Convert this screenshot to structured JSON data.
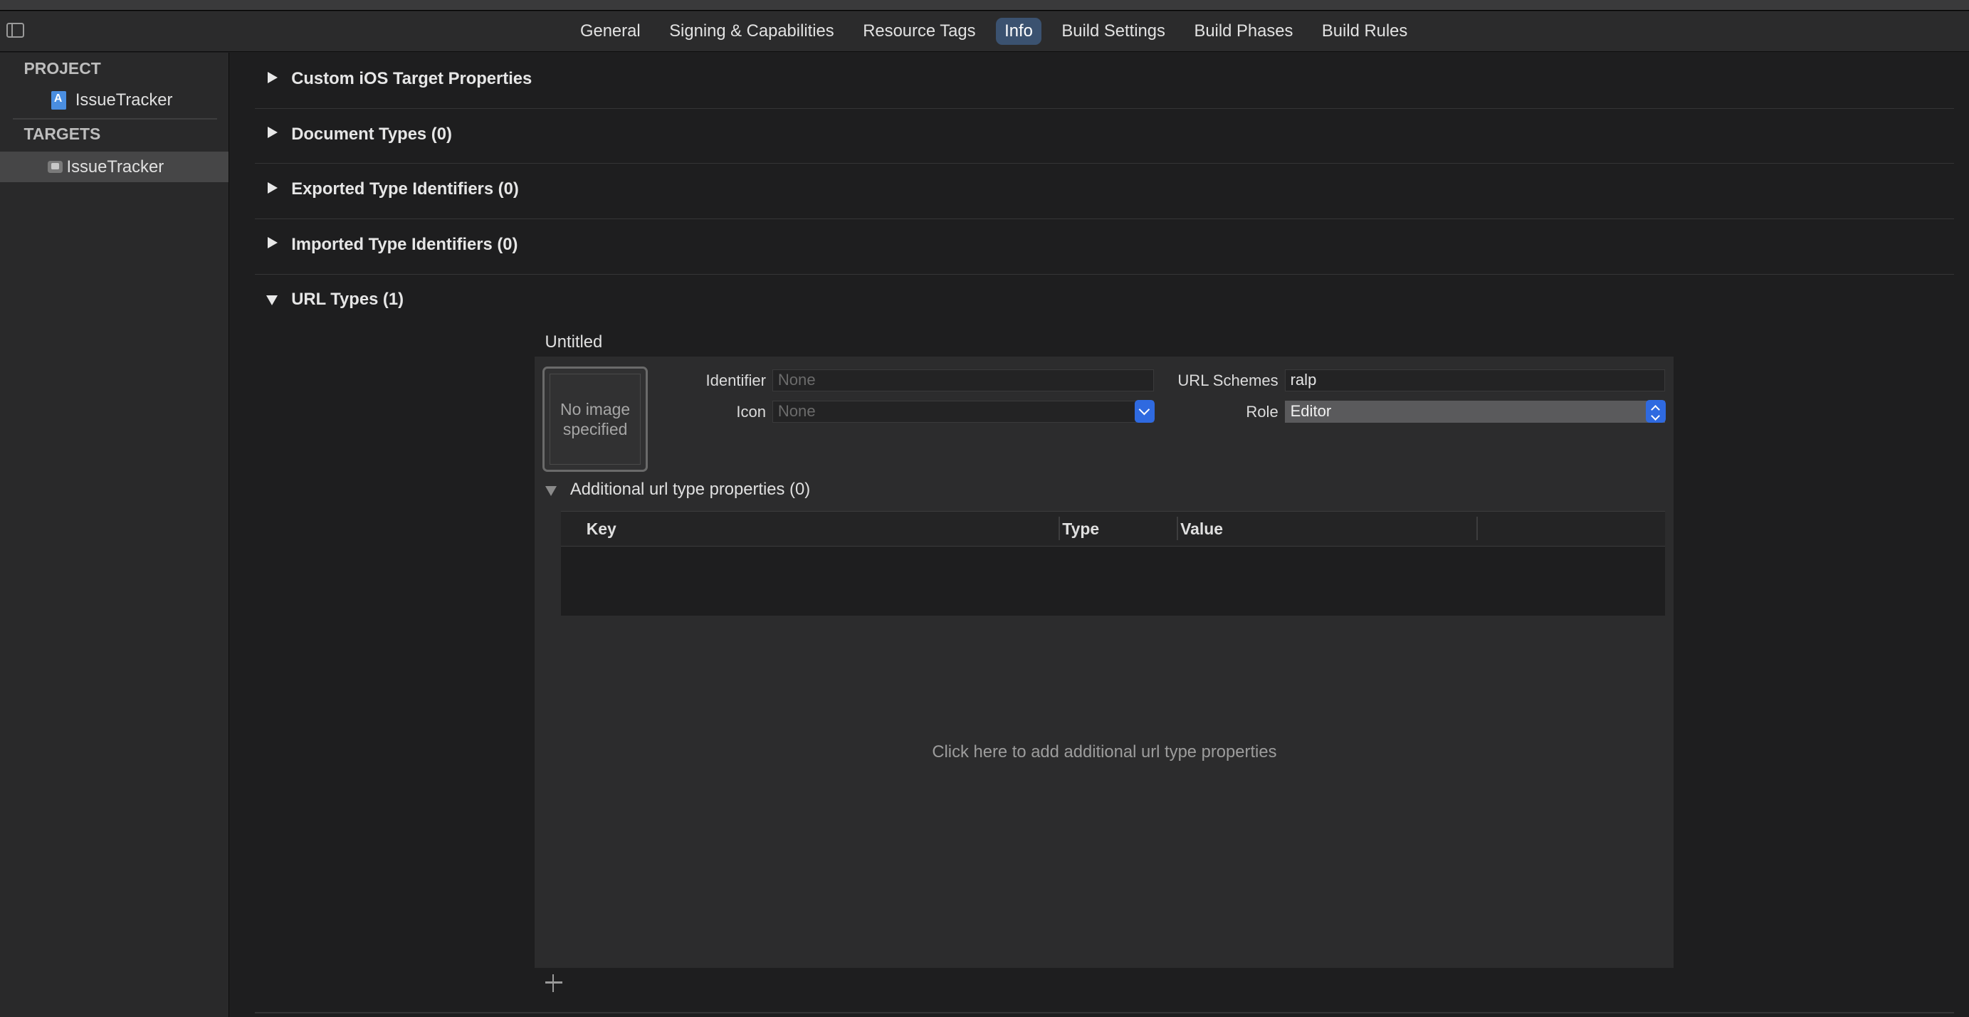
{
  "tabbar": {
    "tabs": [
      {
        "label": "General",
        "active": false
      },
      {
        "label": "Signing & Capabilities",
        "active": false
      },
      {
        "label": "Resource Tags",
        "active": false
      },
      {
        "label": "Info",
        "active": true
      },
      {
        "label": "Build Settings",
        "active": false
      },
      {
        "label": "Build Phases",
        "active": false
      },
      {
        "label": "Build Rules",
        "active": false
      }
    ]
  },
  "sidebar": {
    "project_heading": "PROJECT",
    "project_item": "IssueTracker",
    "targets_heading": "TARGETS",
    "target_item": "IssueTracker"
  },
  "sections": [
    {
      "title": "Custom iOS Target Properties",
      "expanded": false
    },
    {
      "title": "Document Types (0)",
      "expanded": false
    },
    {
      "title": "Exported Type Identifiers (0)",
      "expanded": false
    },
    {
      "title": "Imported Type Identifiers (0)",
      "expanded": false
    },
    {
      "title": "URL Types (1)",
      "expanded": true
    }
  ],
  "url_type": {
    "name": "Untitled",
    "image_placeholder": "No image specified",
    "identifier_label": "Identifier",
    "identifier_placeholder": "None",
    "icon_label": "Icon",
    "icon_placeholder": "None",
    "url_schemes_label": "URL Schemes",
    "url_schemes_value": "ralp",
    "role_label": "Role",
    "role_value": "Editor",
    "additional_title": "Additional url type properties (0)",
    "table_columns": [
      "Key",
      "Type",
      "Value"
    ],
    "empty_message": "Click here to add additional url type properties"
  },
  "colors": {
    "background": "#1e1e1f",
    "accent": "#2f6ae0",
    "active_tab": "#3b5270"
  }
}
